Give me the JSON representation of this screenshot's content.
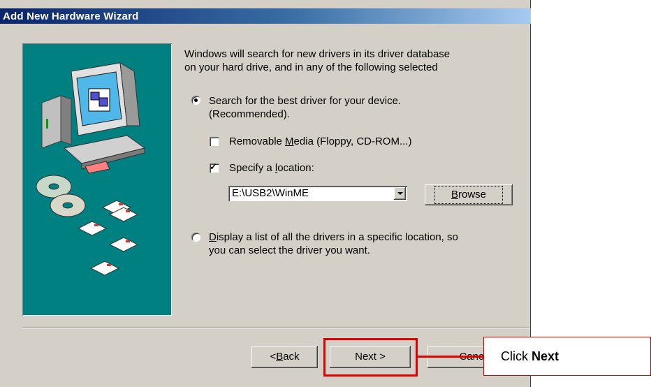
{
  "window": {
    "title": "Add New Hardware Wizard"
  },
  "intro": {
    "line1": "Windows will search for new drivers in its driver database",
    "line2": "on your hard drive, and in any of the following selected"
  },
  "option_search": {
    "line1": "Search for the best driver for your device.",
    "line2": "(Recommended).",
    "selected": true
  },
  "removable_media": {
    "access_key": "M",
    "pre": "Removable ",
    "post": "edia (Floppy, CD-ROM...)",
    "checked": false
  },
  "specify_location": {
    "pre": "Specify a ",
    "access_key": "l",
    "post": "ocation:",
    "checked": true
  },
  "location_combo": {
    "value": "E:\\USB2\\WinME"
  },
  "browse_button": {
    "pre": "",
    "access_key": "B",
    "post": "rowse"
  },
  "option_display": {
    "access_key": "D",
    "line1_rest": "isplay a list of all the drivers in a specific location, so",
    "line2": "you can select the driver you want.",
    "selected": false
  },
  "buttons": {
    "back": {
      "prefix": "< ",
      "access_key": "B",
      "post": "ack"
    },
    "next": "Next >",
    "cancel": "Canc"
  },
  "callout": {
    "prefix": "Click ",
    "bold": "Next"
  },
  "colors": {
    "highlight": "#e00000",
    "artwork_bg": "#008080",
    "titlebar": "#0a246a"
  },
  "icons": [
    "computer-monitor-icon",
    "floppy-disk-icon",
    "cd-rom-icon"
  ]
}
